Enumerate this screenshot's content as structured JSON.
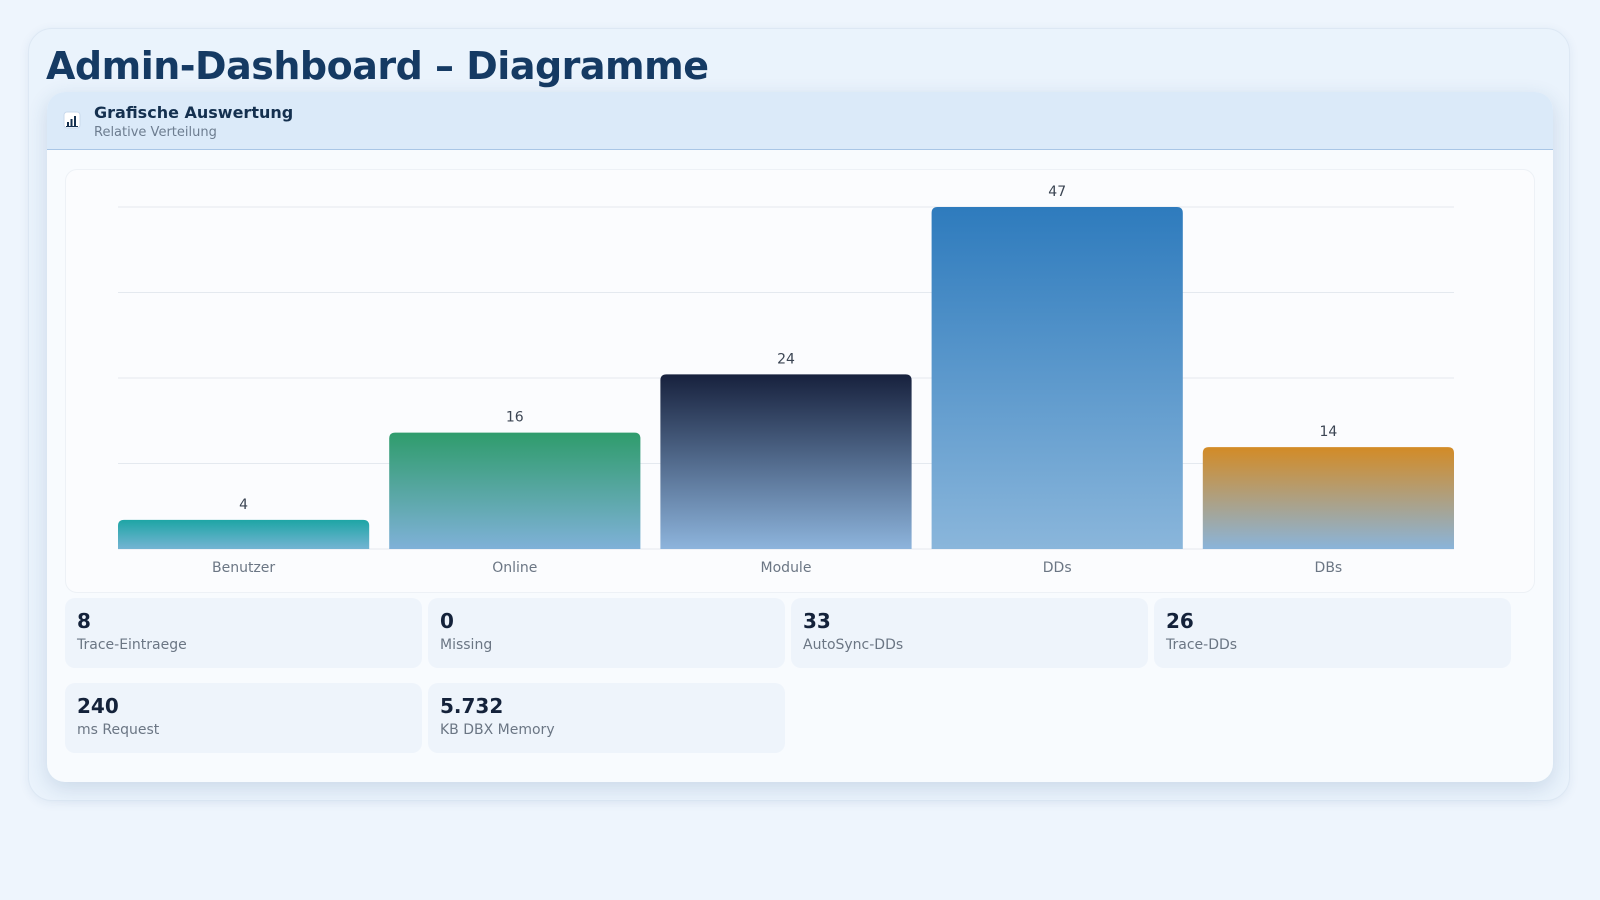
{
  "page": {
    "title": "Admin-Dashboard – Diagramme"
  },
  "card": {
    "title": "Grafische Auswertung",
    "subtitle": "Relative Verteilung",
    "icon": "bar-chart-icon"
  },
  "chart_data": {
    "type": "bar",
    "categories": [
      "Benutzer",
      "Online",
      "Module",
      "DDs",
      "DBs"
    ],
    "values": [
      4,
      16,
      24,
      47,
      14
    ],
    "title": "",
    "xlabel": "",
    "ylabel": "",
    "ylim": [
      0,
      47
    ],
    "grid": true,
    "colors": [
      {
        "top": "#1ea5a5",
        "bottom": "#74b4d3"
      },
      {
        "top": "#2f9c6c",
        "bottom": "#7fb1d8"
      },
      {
        "top": "#17213d",
        "bottom": "#8db4dc"
      },
      {
        "top": "#2e7bbd",
        "bottom": "#8ab6db"
      },
      {
        "top": "#d38b26",
        "bottom": "#8ab4da"
      }
    ]
  },
  "stats": [
    {
      "value": "8",
      "label": "Trace-Eintraege"
    },
    {
      "value": "0",
      "label": "Missing"
    },
    {
      "value": "33",
      "label": "AutoSync-DDs"
    },
    {
      "value": "26",
      "label": "Trace-DDs"
    },
    {
      "value": "240",
      "label": "ms Request"
    },
    {
      "value": "5.732",
      "label": "KB DBX Memory"
    }
  ]
}
